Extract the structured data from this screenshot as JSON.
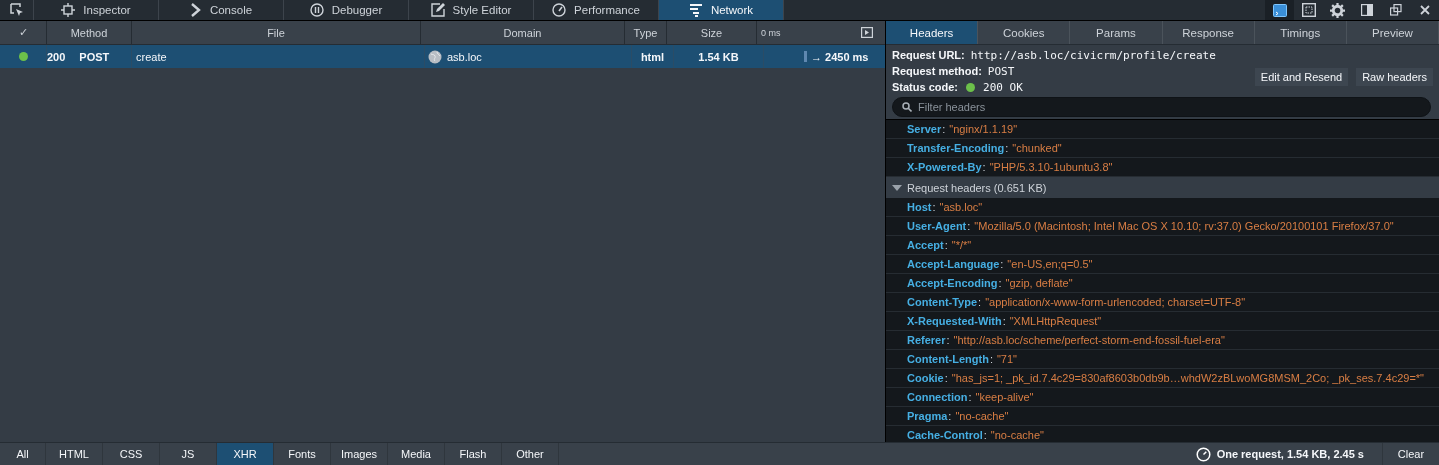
{
  "toolbar": {
    "tools": [
      {
        "label": "Inspector",
        "kind": "inspector",
        "selected": false
      },
      {
        "label": "Console",
        "kind": "console",
        "selected": false
      },
      {
        "label": "Debugger",
        "kind": "debugger",
        "selected": false
      },
      {
        "label": "Style Editor",
        "kind": "style",
        "selected": false
      },
      {
        "label": "Performance",
        "kind": "performance",
        "selected": false
      },
      {
        "label": "Network",
        "kind": "network",
        "selected": true
      }
    ],
    "actions": [
      {
        "kind": "split-console",
        "selected": true
      },
      {
        "kind": "frame",
        "selected": false
      },
      {
        "kind": "settings",
        "selected": false
      },
      {
        "kind": "dock",
        "selected": false
      },
      {
        "kind": "window",
        "selected": false
      },
      {
        "kind": "close",
        "selected": false
      }
    ]
  },
  "table": {
    "columns": [
      "✓",
      "Method",
      "File",
      "Domain",
      "Type",
      "Size",
      "0 ms"
    ],
    "rows": [
      {
        "status": "200",
        "color": "#6cc04a",
        "method": "POST",
        "file": "create",
        "domain": "asb.loc",
        "type": "html",
        "size": "1.54 KB",
        "timing": "→ 2450 ms",
        "selected": true
      }
    ]
  },
  "details": {
    "tabs": [
      {
        "label": "Headers",
        "selected": true
      },
      {
        "label": "Cookies",
        "selected": false
      },
      {
        "label": "Params",
        "selected": false
      },
      {
        "label": "Response",
        "selected": false
      },
      {
        "label": "Timings",
        "selected": false
      },
      {
        "label": "Preview",
        "selected": false
      }
    ],
    "request_url": {
      "label": "Request URL:",
      "value": "http://asb.loc/civicrm/profile/create"
    },
    "request_method": {
      "label": "Request method:",
      "value": "POST"
    },
    "status_code": {
      "label": "Status code:",
      "value": "200 OK",
      "color": "#6cc04a"
    },
    "buttons": [
      "Edit and Resend",
      "Raw headers"
    ],
    "filter": {
      "placeholder": "Filter headers"
    },
    "sections": [
      {
        "headers": [
          {
            "name": "Server",
            "separator": ":",
            "value": "\"nginx/1.1.19\""
          },
          {
            "name": "Transfer-Encoding",
            "separator": ":",
            "value": "\"chunked\""
          },
          {
            "name": "X-Powered-By",
            "separator": ":",
            "value": "\"PHP/5.3.10-1ubuntu3.8\""
          }
        ]
      },
      {
        "title": "Request headers (0.651 KB)",
        "expanded": true,
        "headers": [
          {
            "name": "Host",
            "separator": ":",
            "value": "\"asb.loc\""
          },
          {
            "name": "User-Agent",
            "separator": ":",
            "value": "\"Mozilla/5.0 (Macintosh; Intel Mac OS X 10.10; rv:37.0) Gecko/20100101 Firefox/37.0\""
          },
          {
            "name": "Accept",
            "separator": ":",
            "value": "\"*/*\""
          },
          {
            "name": "Accept-Language",
            "separator": ":",
            "value": "\"en-US,en;q=0.5\""
          },
          {
            "name": "Accept-Encoding",
            "separator": ":",
            "value": "\"gzip, deflate\""
          },
          {
            "name": "Content-Type",
            "separator": ":",
            "value": "\"application/x-www-form-urlencoded; charset=UTF-8\""
          },
          {
            "name": "X-Requested-With",
            "separator": ":",
            "value": "\"XMLHttpRequest\""
          },
          {
            "name": "Referer",
            "separator": ":",
            "value": "\"http://asb.loc/scheme/perfect-storm-end-fossil-fuel-era\""
          },
          {
            "name": "Content-Length",
            "separator": ":",
            "value": "\"71\""
          },
          {
            "name": "Cookie",
            "separator": ":",
            "value": "\"has_js=1; _pk_id.7.4c29=830af8603b0db9b…whdW2zBLwoMG8MSM_2Co; _pk_ses.7.4c29=*\""
          },
          {
            "name": "Connection",
            "separator": ":",
            "value": "\"keep-alive\""
          },
          {
            "name": "Pragma",
            "separator": ":",
            "value": "\"no-cache\""
          },
          {
            "name": "Cache-Control",
            "separator": ":",
            "value": "\"no-cache\""
          }
        ]
      }
    ]
  },
  "filters": [
    {
      "label": "All",
      "selected": false
    },
    {
      "label": "HTML",
      "selected": false
    },
    {
      "label": "CSS",
      "selected": false
    },
    {
      "label": "JS",
      "selected": false
    },
    {
      "label": "XHR",
      "selected": true
    },
    {
      "label": "Fonts",
      "selected": false
    },
    {
      "label": "Images",
      "selected": false
    },
    {
      "label": "Media",
      "selected": false
    },
    {
      "label": "Flash",
      "selected": false
    },
    {
      "label": "Other",
      "selected": false
    }
  ],
  "summary": "One request, 1.54 KB, 2.45 s",
  "clear_button": "Clear"
}
